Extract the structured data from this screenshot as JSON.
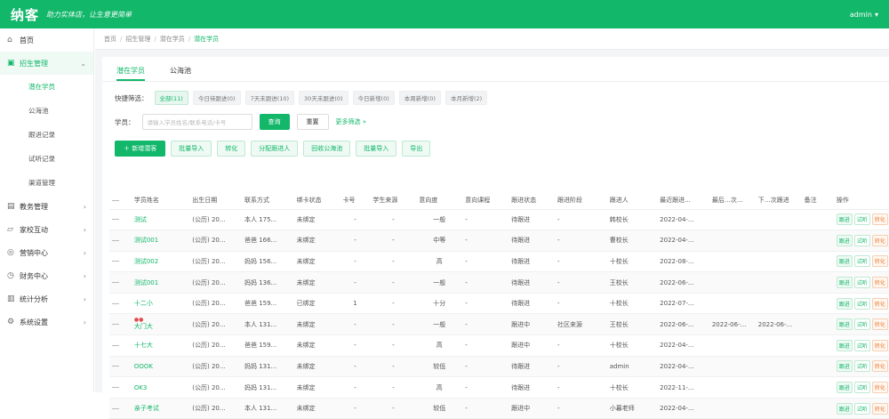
{
  "brand": {
    "logo": "纳客",
    "slogan": "助力实体店，让生意更简单"
  },
  "user": {
    "name": "admin",
    "caret": "▾"
  },
  "colors": {
    "accent": "#12b76a",
    "warn": "#e8813c",
    "danger": "#e14b4b"
  },
  "sidebar": {
    "items": [
      {
        "icon": "home-icon",
        "glyph": "⌂",
        "label": "首页",
        "arrow": ""
      },
      {
        "icon": "student-icon",
        "glyph": "▣",
        "label": "招生管理",
        "arrow": "⌄",
        "active": true
      },
      {
        "icon": "book-icon",
        "glyph": "▤",
        "label": "教务管理",
        "arrow": "›"
      },
      {
        "icon": "chat-icon",
        "glyph": "▱",
        "label": "家校互动",
        "arrow": "›"
      },
      {
        "icon": "shop-icon",
        "glyph": "◎",
        "label": "营销中心",
        "arrow": "›"
      },
      {
        "icon": "finance-icon",
        "glyph": "◷",
        "label": "财务中心",
        "arrow": "›"
      },
      {
        "icon": "chart-icon",
        "glyph": "▥",
        "label": "统计分析",
        "arrow": "›"
      },
      {
        "icon": "gear-icon",
        "glyph": "⚙",
        "label": "系统设置",
        "arrow": "›"
      }
    ],
    "subitems": [
      {
        "label": "潜在学员",
        "active": true
      },
      {
        "label": "公海池"
      },
      {
        "label": "跟进记录"
      },
      {
        "label": "试听记录"
      },
      {
        "label": "渠道管理"
      }
    ]
  },
  "breadcrumb": [
    "首页",
    "招生管理",
    "潜在学员",
    "潜在学员"
  ],
  "tabs": [
    "潜在学员",
    "公海池"
  ],
  "quick_filter": {
    "label": "快捷筛选：",
    "chips": [
      "全部(11)",
      "今日待跟进(0)",
      "7天未跟进(10)",
      "30天未跟进(0)",
      "今日新增(0)",
      "本周新增(0)",
      "本月新增(2)"
    ]
  },
  "search": {
    "label": "学员：",
    "placeholder": "请输入学员姓名/联系电话/卡号",
    "submit": "查询",
    "reset": "重置",
    "more": "更多筛选 »"
  },
  "actions": [
    "＋ 新增潜客",
    "批量导入",
    "转化",
    "分配跟进人",
    "回收公海池",
    "批量导入",
    "导出"
  ],
  "table": {
    "columns": [
      "学员姓名",
      "出生日期",
      "联系方式",
      "绑卡状态",
      "卡号",
      "学生来源",
      "意向度",
      "意向课程",
      "跟进状态",
      "跟进阶段",
      "跟进人",
      "最近跟进...",
      "最后…次…",
      "下…次跟进",
      "备注",
      "操作"
    ],
    "rows": [
      [
        "测试",
        "(公历) 20...",
        "本人 175...",
        "未绑定",
        "-",
        "-",
        "一般",
        "-",
        "待跟进",
        "-",
        "韩校长",
        "2022-04-...",
        "",
        "",
        "",
        ""
      ],
      [
        "测试001",
        "(公历) 20...",
        "爸爸 166...",
        "未绑定",
        "-",
        "-",
        "中等",
        "-",
        "待跟进",
        "-",
        "曹校长",
        "2022-04-...",
        "",
        "",
        "",
        ""
      ],
      [
        "测试002",
        "(公历) 20...",
        "妈妈 156...",
        "未绑定",
        "-",
        "-",
        "高",
        "-",
        "待跟进",
        "-",
        "十校长",
        "2022-08-...",
        "",
        "",
        "",
        ""
      ],
      [
        "测试001",
        "(公历) 20...",
        "妈妈 136...",
        "未绑定",
        "-",
        "-",
        "一般",
        "-",
        "待跟进",
        "-",
        "王校长",
        "2022-06-...",
        "",
        "",
        "",
        ""
      ],
      [
        "十二小",
        "(公历) 20...",
        "爸爸 159...",
        "已绑定",
        "1",
        "-",
        "十分",
        "-",
        "待跟进",
        "-",
        "十校长",
        "2022-07-...",
        "",
        "",
        "",
        ""
      ],
      [
        "大门大",
        "(公历) 20...",
        "本人 131...",
        "未绑定",
        "-",
        "-",
        "一般",
        "-",
        "跟进中",
        "社区来源",
        "王校长",
        "2022-06-...",
        "2022-06-...",
        "2022-06-...",
        "",
        ""
      ],
      [
        "十七大",
        "(公历) 20...",
        "爸爸 159...",
        "未绑定",
        "-",
        "-",
        "高",
        "-",
        "跟进中",
        "-",
        "十校长",
        "2022-04-...",
        "",
        "",
        "",
        ""
      ],
      [
        "OOOK",
        "(公历) 20...",
        "妈妈 131...",
        "未绑定",
        "-",
        "-",
        "较低",
        "-",
        "待跟进",
        "-",
        "admin",
        "2022-04-...",
        "",
        "",
        "",
        ""
      ],
      [
        "OK3",
        "(公历) 20...",
        "妈妈 131...",
        "未绑定",
        "-",
        "-",
        "高",
        "-",
        "待跟进",
        "-",
        "十校长",
        "2022-11-...",
        "",
        "",
        "",
        ""
      ],
      [
        "亲子考试",
        "(公历) 20...",
        "本人 131...",
        "未绑定",
        "-",
        "-",
        "较低",
        "-",
        "跟进中",
        "-",
        "小暮老师",
        "2022-04-...",
        "",
        "",
        "",
        ""
      ]
    ],
    "ops": [
      "跟进",
      "试听",
      "转化"
    ]
  }
}
